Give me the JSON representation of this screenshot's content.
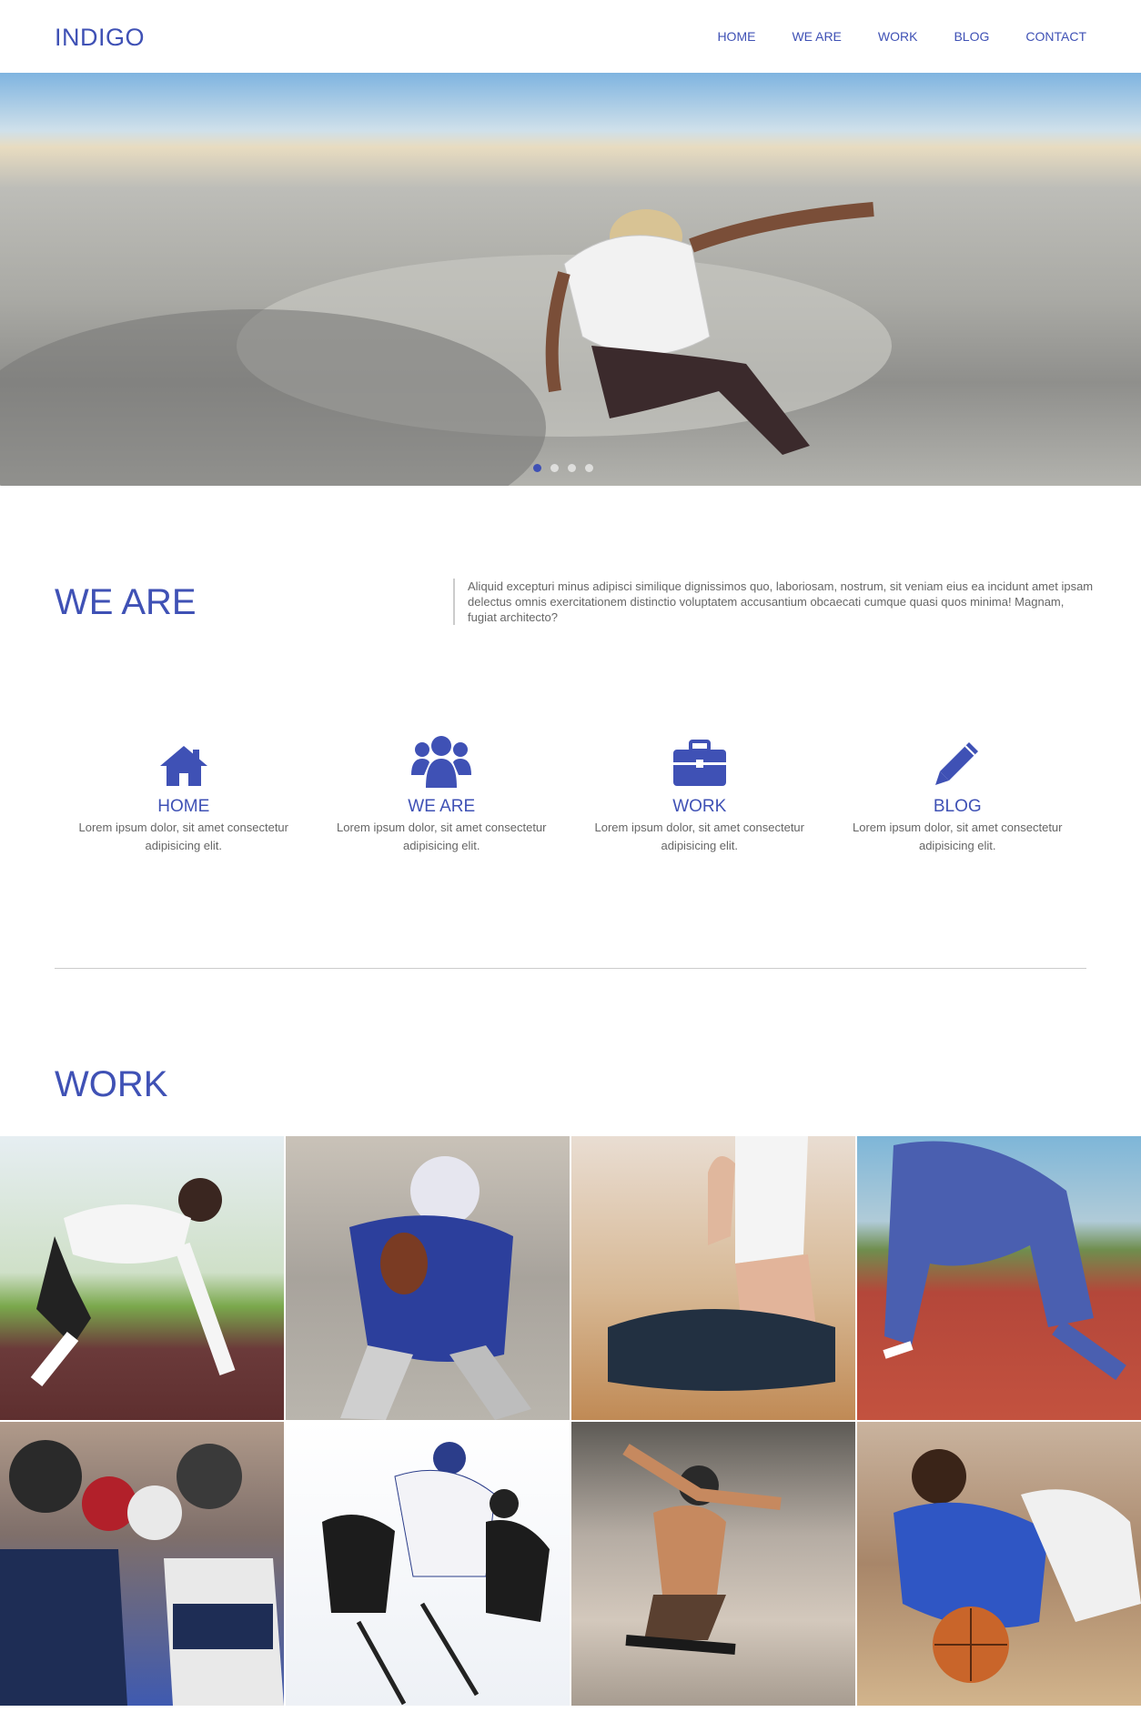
{
  "header": {
    "logo": "INDIGO",
    "nav": [
      "HOME",
      "WE ARE",
      "WORK",
      "BLOG",
      "CONTACT"
    ]
  },
  "hero": {
    "slides": 4,
    "active_slide": 1
  },
  "weare": {
    "title": "WE ARE",
    "text": "Aliquid excepturi minus adipisci similique dignissimos quo, laboriosam, nostrum, sit veniam eius ea incidunt amet ipsam delectus omnis exercitationem distinctio voluptatem accusantium obcaecati cumque quasi quos minima! Magnam, fugiat architecto?"
  },
  "features": [
    {
      "icon": "home-icon",
      "title": "HOME",
      "text": "Lorem ipsum dolor, sit amet consectetur adipisicing elit."
    },
    {
      "icon": "users-icon",
      "title": "WE ARE",
      "text": "Lorem ipsum dolor, sit amet consectetur adipisicing elit."
    },
    {
      "icon": "briefcase-icon",
      "title": "WORK",
      "text": "Lorem ipsum dolor, sit amet consectetur adipisicing elit."
    },
    {
      "icon": "pencil-icon",
      "title": "BLOG",
      "text": "Lorem ipsum dolor, sit amet consectetur adipisicing elit."
    }
  ],
  "work": {
    "title": "WORK",
    "tiles": [
      "sprinter-start",
      "football-quarterback",
      "yoga-pose",
      "runner-track",
      "boxers",
      "hockey-players",
      "skateboarder-ramp",
      "basketball-player"
    ]
  },
  "colors": {
    "accent": "#3f51b5",
    "text": "#666666",
    "divider": "#cccccc"
  }
}
